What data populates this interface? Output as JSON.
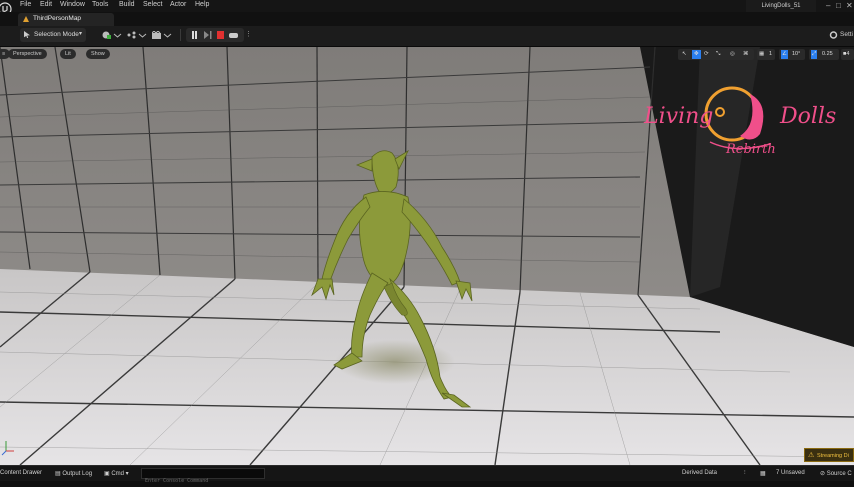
{
  "menu": [
    "File",
    "Edit",
    "Window",
    "Tools",
    "Build",
    "Select",
    "Actor",
    "Help"
  ],
  "project_name": "LivingDolls_51",
  "window_controls": {
    "minimize": "–",
    "maximize": "□",
    "close": "✕"
  },
  "tab": {
    "label": "ThirdPersonMap"
  },
  "toolbar": {
    "selection_mode": "Selection Mode",
    "settings_label": "Setti"
  },
  "viewport": {
    "menu_label": "≡",
    "perspective": "Perspective",
    "lit": "Lit",
    "show": "Show",
    "grid_snap": "1",
    "rotation_snap": "10°",
    "scale_snap": "0.25",
    "camera_speed": "4"
  },
  "watermark": {
    "line1": "Living",
    "line2": "Dolls",
    "line3": "Rebirth"
  },
  "notification": "Streaming Di",
  "statusbar": {
    "content_drawer": "Content Drawer",
    "output_log": "Output Log",
    "cmd": "Cmd",
    "console_placeholder": "Enter Console Command",
    "derived_data": "Derived Data",
    "unsaved": "7 Unsaved",
    "source_control": "Source C"
  },
  "colors": {
    "accent_blue": "#2a7ff0",
    "stop_red": "#e03030",
    "watermark_pink": "#f04f8a",
    "warning_yellow": "#f0c040"
  }
}
